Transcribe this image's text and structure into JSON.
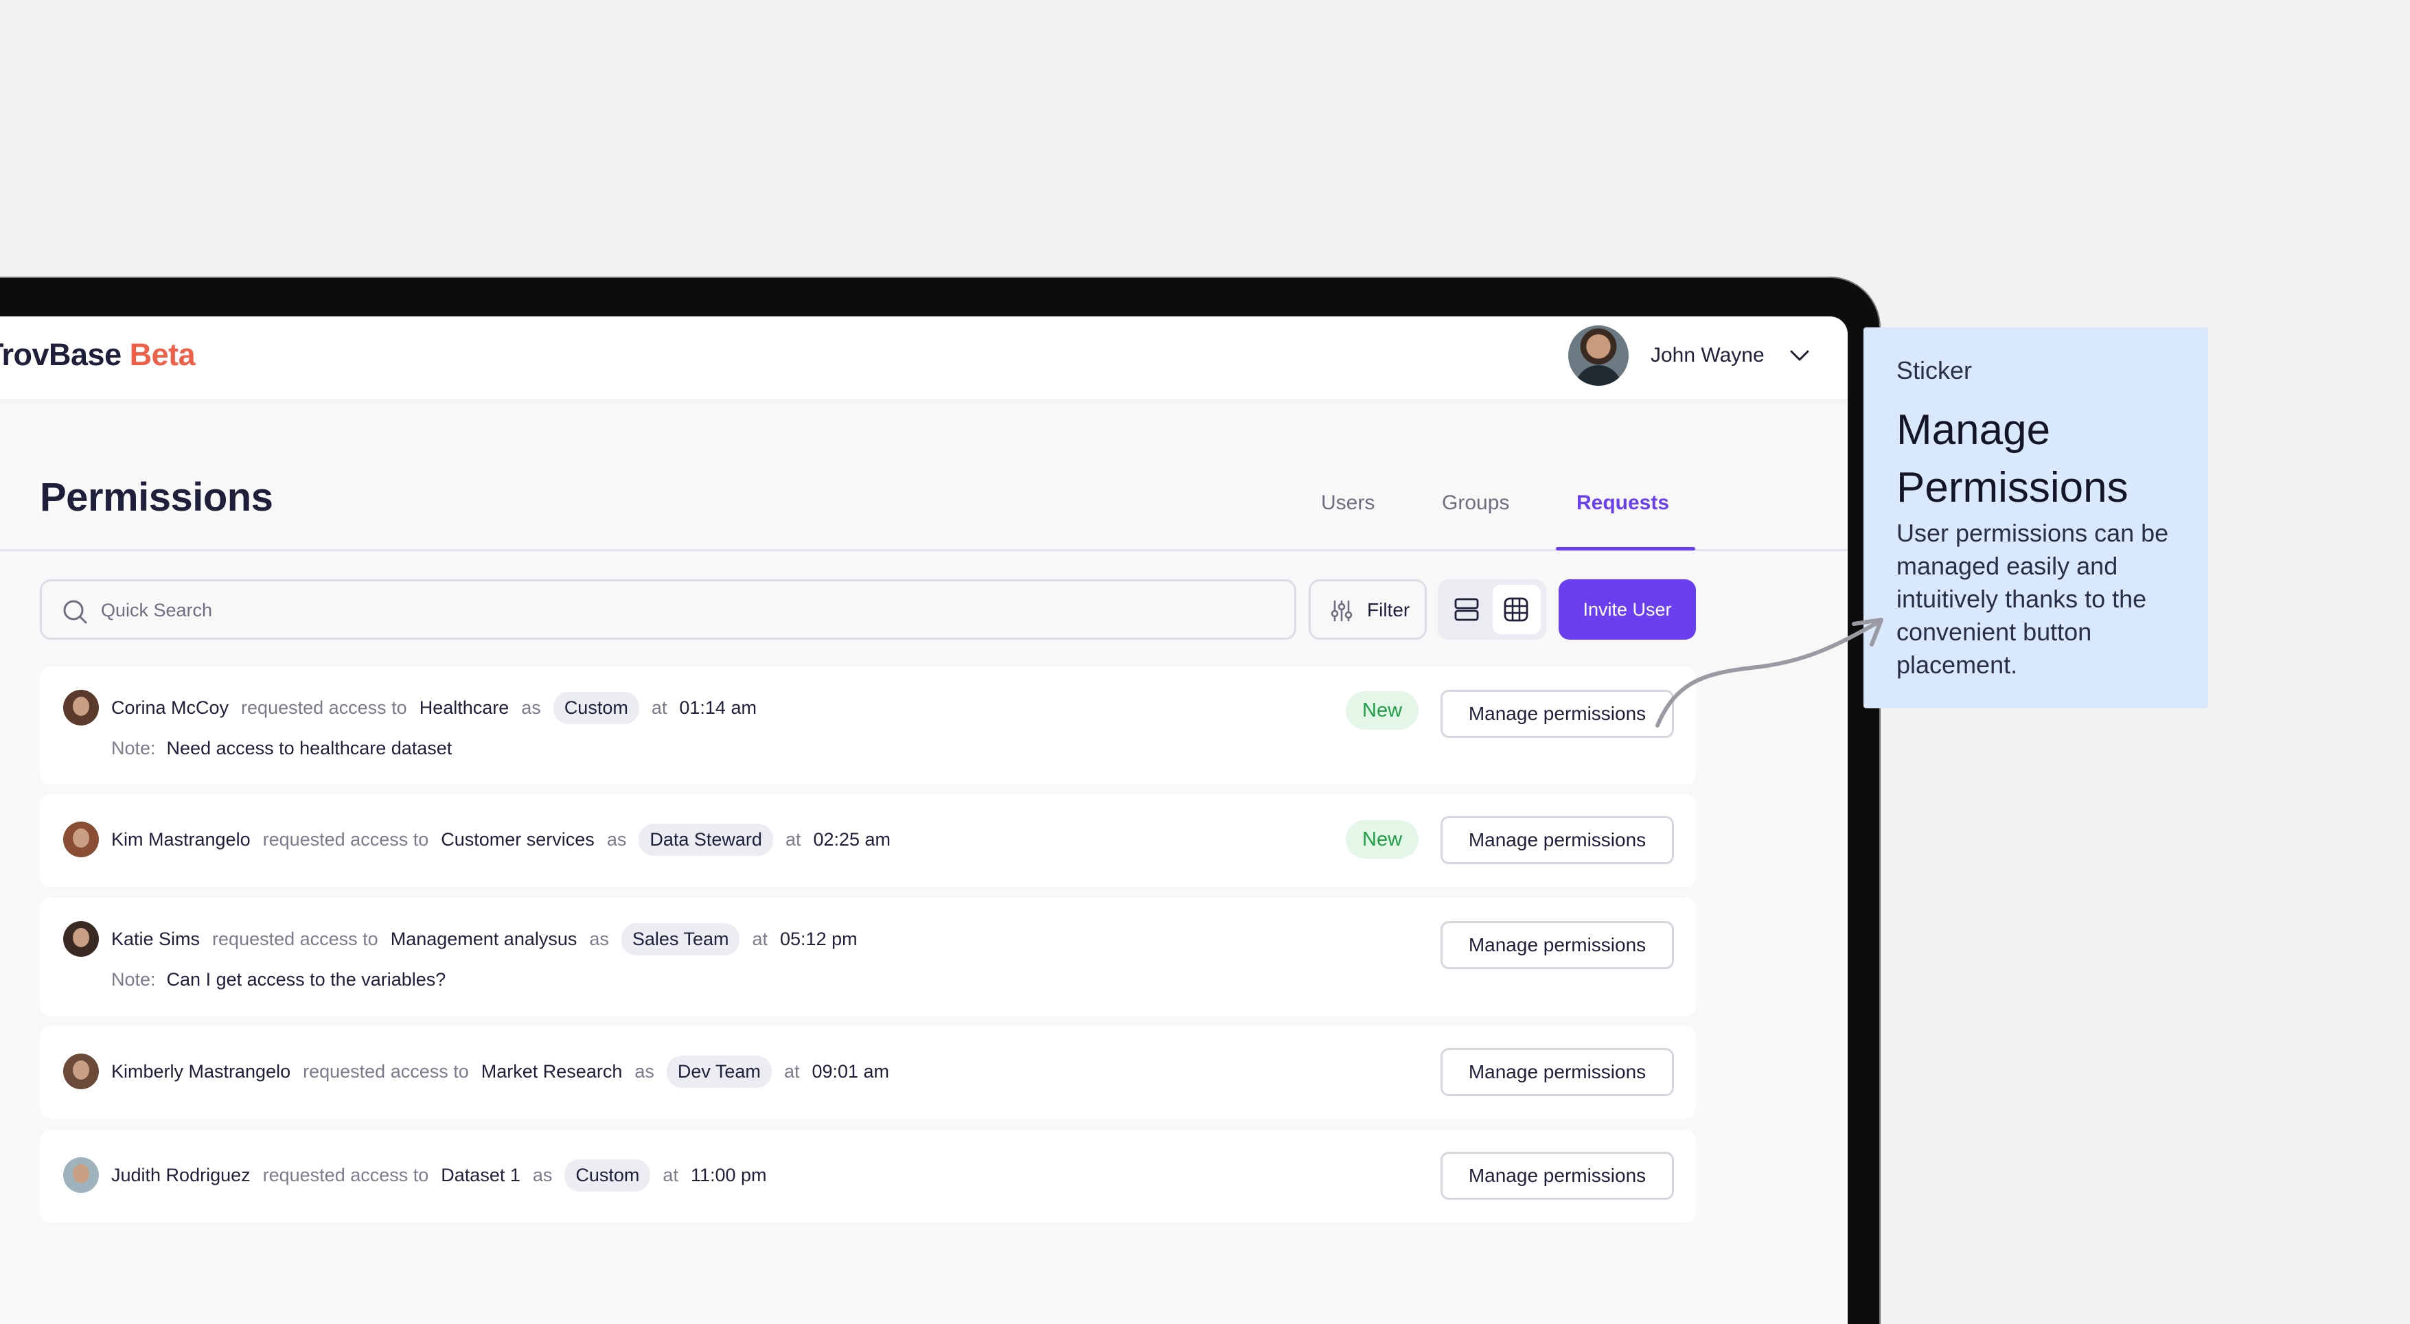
{
  "app": {
    "brand_name": "TrovBase",
    "brand_suffix": "Beta"
  },
  "user": {
    "name": "John Wayne"
  },
  "page": {
    "title": "Permissions"
  },
  "tabs": [
    {
      "label": "Users",
      "active": false
    },
    {
      "label": "Groups",
      "active": false
    },
    {
      "label": "Requests",
      "active": true
    }
  ],
  "toolbar": {
    "search_placeholder": "Quick Search",
    "filter_label": "Filter",
    "invite_label": "Invite User"
  },
  "requests": [
    {
      "name": "Corina McCoy",
      "verb": "requested access to",
      "resource": "Healthcare",
      "as": "as",
      "role": "Custom",
      "at": "at",
      "time": "01:14 am",
      "note_label": "Note:",
      "note": "Need access to healthcare dataset",
      "badge": "New",
      "action": "Manage permissions"
    },
    {
      "name": "Kim Mastrangelo",
      "verb": "requested access to",
      "resource": "Customer services",
      "as": "as",
      "role": "Data Steward",
      "at": "at",
      "time": "02:25 am",
      "badge": "New",
      "action": "Manage permissions"
    },
    {
      "name": "Katie Sims",
      "verb": "requested access to",
      "resource": "Management analysus",
      "as": "as",
      "role": "Sales Team",
      "at": "at",
      "time": "05:12 pm",
      "note_label": "Note:",
      "note": "Can I get access to the variables?",
      "action": "Manage permissions"
    },
    {
      "name": "Kimberly Mastrangelo",
      "verb": "requested access to",
      "resource": "Market Research",
      "as": "as",
      "role": "Dev Team",
      "at": "at",
      "time": "09:01 am",
      "action": "Manage permissions"
    },
    {
      "name": "Judith Rodriguez",
      "verb": "requested access to",
      "resource": "Dataset 1",
      "as": "as",
      "role": "Custom",
      "at": "at",
      "time": "11:00 pm",
      "action": "Manage permissions"
    }
  ],
  "sticker": {
    "tag": "Sticker",
    "title": "Manage Permissions",
    "body": "User permissions can be managed easily and intuitively thanks to the convenient button placement."
  },
  "colors": {
    "accent": "#6a3ff0",
    "brand_suffix": "#ef5e47",
    "badge_new_text": "#1fa046",
    "badge_new_bg": "#e4f6e8",
    "sticker_bg": "#d9e8fb"
  },
  "icons": {
    "search": "search-icon",
    "filter": "filter-sliders-icon",
    "list_view": "list-view-icon",
    "grid_view": "grid-view-icon",
    "dropdown": "chevron-down-icon"
  }
}
